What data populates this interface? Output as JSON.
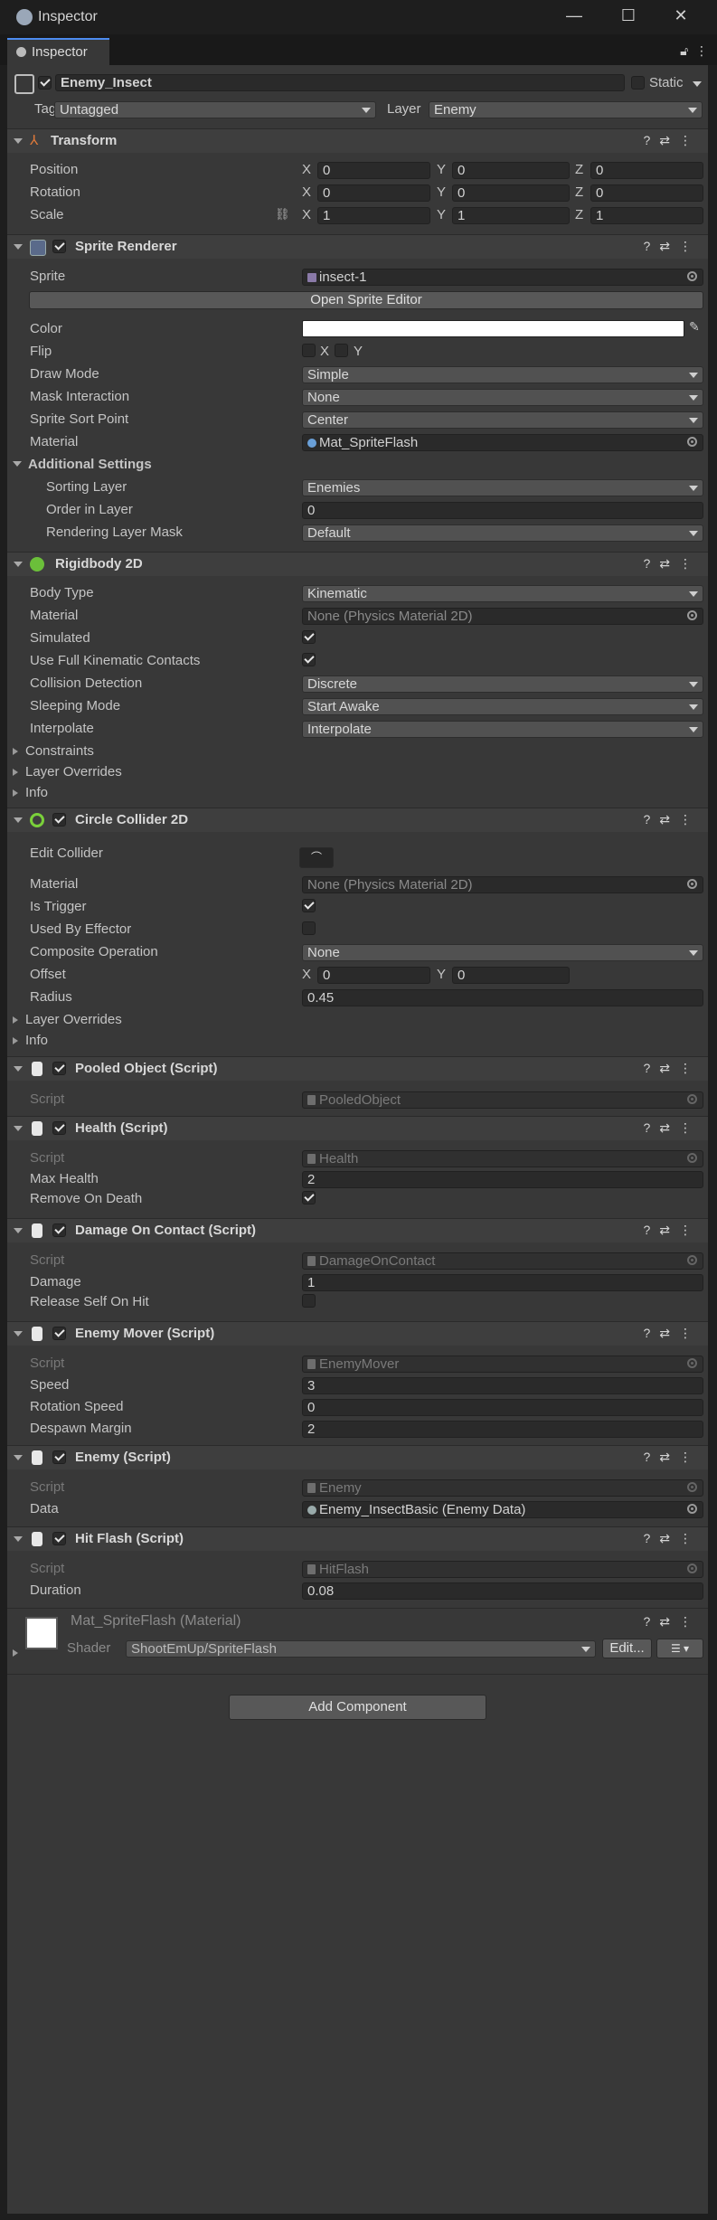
{
  "window": {
    "title": "Inspector",
    "tab": "Inspector"
  },
  "object": {
    "name": "Enemy_Insect",
    "static_label": "Static",
    "tag_label": "Tag",
    "tag_value": "Untagged",
    "layer_label": "Layer",
    "layer_value": "Enemy",
    "active": true,
    "static": false
  },
  "transform": {
    "title": "Transform",
    "rows": [
      {
        "label": "Position",
        "x": "0",
        "y": "0",
        "z": "0"
      },
      {
        "label": "Rotation",
        "x": "0",
        "y": "0",
        "z": "0"
      },
      {
        "label": "Scale",
        "x": "1",
        "y": "1",
        "z": "1"
      }
    ]
  },
  "axes": {
    "x": "X",
    "y": "Y",
    "z": "Z"
  },
  "sprite_renderer": {
    "title": "Sprite Renderer",
    "sprite_label": "Sprite",
    "sprite_value": "insect-1",
    "open_editor": "Open Sprite Editor",
    "color_label": "Color",
    "color_value": "#ffffff",
    "flip_label": "Flip",
    "flip_x": "X",
    "flip_y": "Y",
    "draw_mode_label": "Draw Mode",
    "draw_mode": "Simple",
    "mask_label": "Mask Interaction",
    "mask": "None",
    "sort_point_label": "Sprite Sort Point",
    "sort_point": "Center",
    "material_label": "Material",
    "material": "Mat_SpriteFlash",
    "additional": "Additional Settings",
    "sorting_layer_label": "Sorting Layer",
    "sorting_layer": "Enemies",
    "order_label": "Order in Layer",
    "order": "0",
    "rlm_label": "Rendering Layer Mask",
    "rlm": "Default"
  },
  "rigidbody": {
    "title": "Rigidbody 2D",
    "body_type_label": "Body Type",
    "body_type": "Kinematic",
    "material_label": "Material",
    "material": "None (Physics Material 2D)",
    "simulated_label": "Simulated",
    "full_kin_label": "Use Full Kinematic Contacts",
    "collision_label": "Collision Detection",
    "collision": "Discrete",
    "sleep_label": "Sleeping Mode",
    "sleep": "Start Awake",
    "interp_label": "Interpolate",
    "interp": "Interpolate",
    "constraints": "Constraints",
    "layer_overrides": "Layer Overrides",
    "info": "Info"
  },
  "collider": {
    "title": "Circle Collider 2D",
    "edit_label": "Edit Collider",
    "material_label": "Material",
    "material": "None (Physics Material 2D)",
    "trigger_label": "Is Trigger",
    "effector_label": "Used By Effector",
    "composite_label": "Composite Operation",
    "composite": "None",
    "offset_label": "Offset",
    "offset_x": "0",
    "offset_y": "0",
    "radius_label": "Radius",
    "radius": "0.45",
    "layer_overrides": "Layer Overrides",
    "info": "Info"
  },
  "pooled": {
    "title": "Pooled Object (Script)",
    "script_label": "Script",
    "script": "PooledObject"
  },
  "health": {
    "title": "Health (Script)",
    "script_label": "Script",
    "script": "Health",
    "max_label": "Max Health",
    "max": "2",
    "remove_label": "Remove On Death"
  },
  "damage": {
    "title": "Damage On Contact (Script)",
    "script_label": "Script",
    "script": "DamageOnContact",
    "damage_label": "Damage",
    "damage": "1",
    "release_label": "Release Self On Hit"
  },
  "mover": {
    "title": "Enemy Mover (Script)",
    "script_label": "Script",
    "script": "EnemyMover",
    "speed_label": "Speed",
    "speed": "3",
    "rot_label": "Rotation Speed",
    "rot": "0",
    "despawn_label": "Despawn Margin",
    "despawn": "2"
  },
  "enemy": {
    "title": "Enemy (Script)",
    "script_label": "Script",
    "script": "Enemy",
    "data_label": "Data",
    "data": "Enemy_InsectBasic (Enemy Data)"
  },
  "hitflash": {
    "title": "Hit Flash (Script)",
    "script_label": "Script",
    "script": "HitFlash",
    "duration_label": "Duration",
    "duration": "0.08"
  },
  "material_preview": {
    "title": "Mat_SpriteFlash (Material)",
    "shader_label": "Shader",
    "shader": "ShootEmUp/SpriteFlash",
    "edit": "Edit..."
  },
  "add_component": "Add Component",
  "icons": [
    "inspector-icon",
    "lock-icon",
    "menu-icon",
    "help-icon",
    "preset-icon",
    "kebab-icon",
    "object-picker-icon",
    "eyedropper-icon",
    "link-icon",
    "script-icon",
    "gameobject-icon"
  ],
  "colors": {
    "accent": "#4d8cf0",
    "panel": "#383838",
    "header": "#3e3e3e"
  }
}
